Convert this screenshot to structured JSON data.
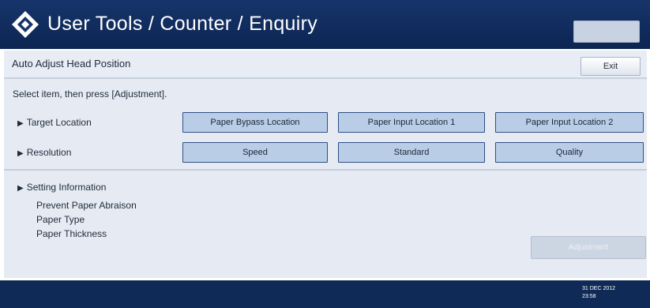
{
  "header": {
    "title": "User Tools / Counter / Enquiry",
    "button_label": ""
  },
  "subheader": {
    "title": "Auto Adjust Head Position",
    "exit_label": "Exit"
  },
  "instruction": "Select item, then press [Adjustment].",
  "target_location": {
    "label": "Target Location",
    "options": [
      "Paper Bypass Location",
      "Paper Input Location 1",
      "Paper Input Location 2"
    ]
  },
  "resolution": {
    "label": "Resolution",
    "options": [
      "Speed",
      "Standard",
      "Quality"
    ]
  },
  "setting_information": {
    "label": "Setting Information",
    "items": [
      "Prevent Paper Abraison",
      "Paper Type",
      "Paper Thickness"
    ]
  },
  "adjustment_label": "Adjustment",
  "footer": {
    "date": "31 DEC 2012",
    "time": "23:58"
  },
  "colors": {
    "header_bg": "#0c2552",
    "option_bg": "#b9cde6",
    "option_border": "#2f4f86",
    "panel_bg": "#e6ebf3"
  },
  "icons": {
    "logo": "diamond-logo-icon",
    "row_marker": "triangle-right-icon"
  }
}
